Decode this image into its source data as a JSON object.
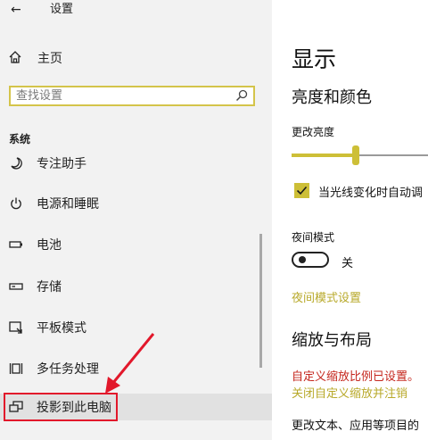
{
  "window": {
    "title": "设置"
  },
  "sidebar": {
    "home_label": "主页",
    "search_placeholder": "查找设置",
    "section_label": "系统",
    "items": [
      {
        "label": "专注助手",
        "icon": "moon-icon"
      },
      {
        "label": "电源和睡眠",
        "icon": "power-icon"
      },
      {
        "label": "电池",
        "icon": "battery-icon"
      },
      {
        "label": "存储",
        "icon": "storage-icon"
      },
      {
        "label": "平板模式",
        "icon": "tablet-mode-icon"
      },
      {
        "label": "多任务处理",
        "icon": "multitasking-icon"
      },
      {
        "label": "投影到此电脑",
        "icon": "project-icon",
        "selected": true
      }
    ]
  },
  "main": {
    "title": "显示",
    "brightness_section": "亮度和颜色",
    "brightness_label": "更改亮度",
    "brightness_value_percent": 45,
    "auto_brightness_label": "当光线变化时自动调",
    "auto_brightness_checked": true,
    "night_mode_label": "夜间模式",
    "night_mode_state": "关",
    "night_mode_on": false,
    "night_mode_settings_link": "夜间模式设置",
    "scale_section": "缩放与布局",
    "custom_scale_warning": "自定义缩放比例已设置。",
    "custom_scale_off_link": "关闭自定义缩放并注销",
    "change_text_label": "更改文本、应用等项目的"
  },
  "colors": {
    "accent": "#cdbf37",
    "annotation": "#e2182b",
    "warning": "#c5271e"
  }
}
